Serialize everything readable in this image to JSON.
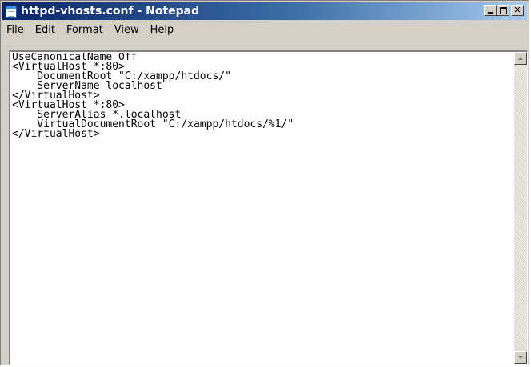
{
  "window": {
    "title": "httpd-vhosts.conf - Notepad",
    "app_icon": "notepad-icon",
    "title_bar_color": "#0a246a"
  },
  "caption_buttons": {
    "minimize_icon": "minimize-icon",
    "maximize_icon": "maximize-icon",
    "close_icon": "close-icon"
  },
  "menubar": {
    "items": [
      {
        "label": "File"
      },
      {
        "label": "Edit"
      },
      {
        "label": "Format"
      },
      {
        "label": "View"
      },
      {
        "label": "Help"
      }
    ]
  },
  "editor": {
    "lines": [
      "UseCanonicalName Off",
      "<VirtualHost *:80>",
      "    DocumentRoot \"C:/xampp/htdocs/\"",
      "    ServerName localhost",
      "</VirtualHost>",
      "<VirtualHost *:80>",
      "    ServerAlias *.localhost",
      "    VirtualDocumentRoot \"C:/xampp/htdocs/%1/\"",
      "</VirtualHost>"
    ]
  },
  "scrollbar": {
    "up_icon": "scroll-up-arrow-icon",
    "down_icon": "scroll-down-arrow-icon"
  }
}
